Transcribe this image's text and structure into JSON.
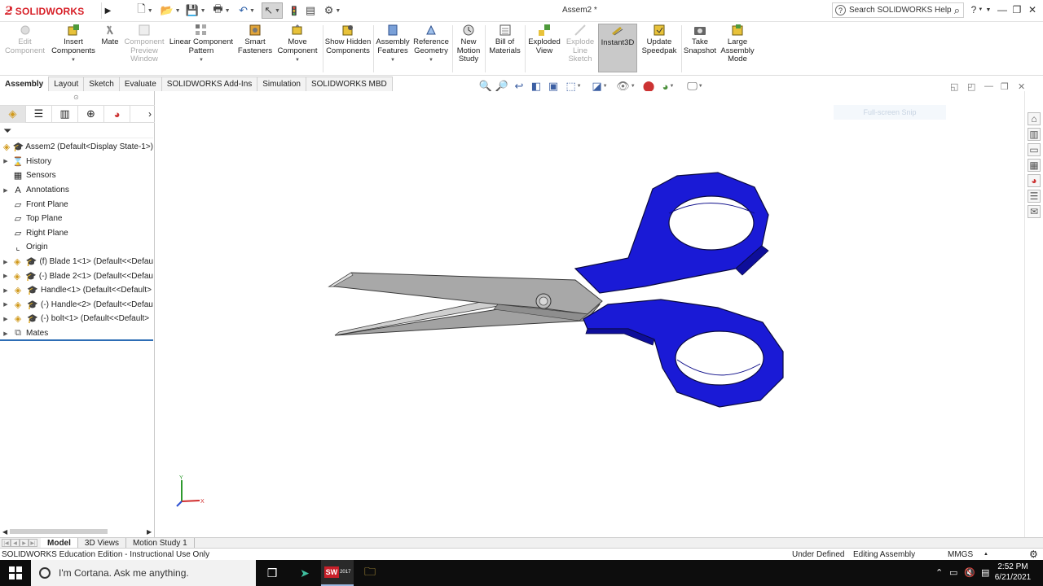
{
  "window": {
    "app_name": "SOLIDWORKS",
    "document_title": "Assem2 *",
    "help_search_placeholder": "Search SOLIDWORKS Help",
    "help_q": "?"
  },
  "commands": [
    {
      "label": "Edit Component",
      "disabled": true
    },
    {
      "label": "Insert Components",
      "disabled": false
    },
    {
      "label": "Mate",
      "disabled": false
    },
    {
      "label": "Component Preview Window",
      "disabled": true
    },
    {
      "label": "Linear Component Pattern",
      "disabled": false
    },
    {
      "label": "Smart Fasteners",
      "disabled": false
    },
    {
      "label": "Move Component",
      "disabled": false
    },
    {
      "label": "Show Hidden Components",
      "disabled": false
    },
    {
      "label": "Assembly Features",
      "disabled": false
    },
    {
      "label": "Reference Geometry",
      "disabled": false
    },
    {
      "label": "New Motion Study",
      "disabled": false
    },
    {
      "label": "Bill of Materials",
      "disabled": false
    },
    {
      "label": "Exploded View",
      "disabled": false
    },
    {
      "label": "Explode Line Sketch",
      "disabled": true
    },
    {
      "label": "Instant3D",
      "disabled": false
    },
    {
      "label": "Update Speedpak",
      "disabled": false
    },
    {
      "label": "Take Snapshot",
      "disabled": false
    },
    {
      "label": "Large Assembly Mode",
      "disabled": false
    }
  ],
  "tabs": [
    "Assembly",
    "Layout",
    "Sketch",
    "Evaluate",
    "SOLIDWORKS Add-Ins",
    "Simulation",
    "SOLIDWORKS MBD"
  ],
  "active_tab": "Assembly",
  "tree": {
    "root": "Assem2  (Default<Display State-1>)",
    "items": [
      {
        "label": "History",
        "icon": "history-icon"
      },
      {
        "label": "Sensors",
        "icon": "sensors-icon"
      },
      {
        "label": "Annotations",
        "icon": "annotations-icon"
      },
      {
        "label": "Front Plane",
        "icon": "plane-icon"
      },
      {
        "label": "Top Plane",
        "icon": "plane-icon"
      },
      {
        "label": "Right Plane",
        "icon": "plane-icon"
      },
      {
        "label": "Origin",
        "icon": "origin-icon"
      },
      {
        "label": "(f) Blade 1<1> (Default<<Defau",
        "icon": "part-icon"
      },
      {
        "label": "(-) Blade 2<1> (Default<<Defau",
        "icon": "part-icon"
      },
      {
        "label": "Handle<1> (Default<<Default>",
        "icon": "part-icon"
      },
      {
        "label": "(-) Handle<2> (Default<<Defau",
        "icon": "part-icon"
      },
      {
        "label": "(-) bolt<1> (Default<<Default>",
        "icon": "part-icon"
      },
      {
        "label": "Mates",
        "icon": "mates-icon"
      }
    ]
  },
  "graphics": {
    "snip_label": "Full-screen Snip",
    "triad_y": "Y",
    "triad_x": "X"
  },
  "bottom_tabs": [
    "Model",
    "3D Views",
    "Motion Study 1"
  ],
  "active_bottom_tab": "Model",
  "status": {
    "edition": "SOLIDWORKS Education Edition - Instructional Use Only",
    "definition": "Under Defined",
    "mode": "Editing Assembly",
    "units": "MMGS",
    "units_caret": "▲"
  },
  "taskbar": {
    "cortana_placeholder": "I'm Cortana. Ask me anything.",
    "time": "2:52 PM",
    "date": "6/21/2021",
    "sw_badge": "2017"
  },
  "colors": {
    "handle_blue": "#1a1ad6",
    "blade_gray": "#a8a8a8",
    "brand_red": "#d71f27"
  }
}
